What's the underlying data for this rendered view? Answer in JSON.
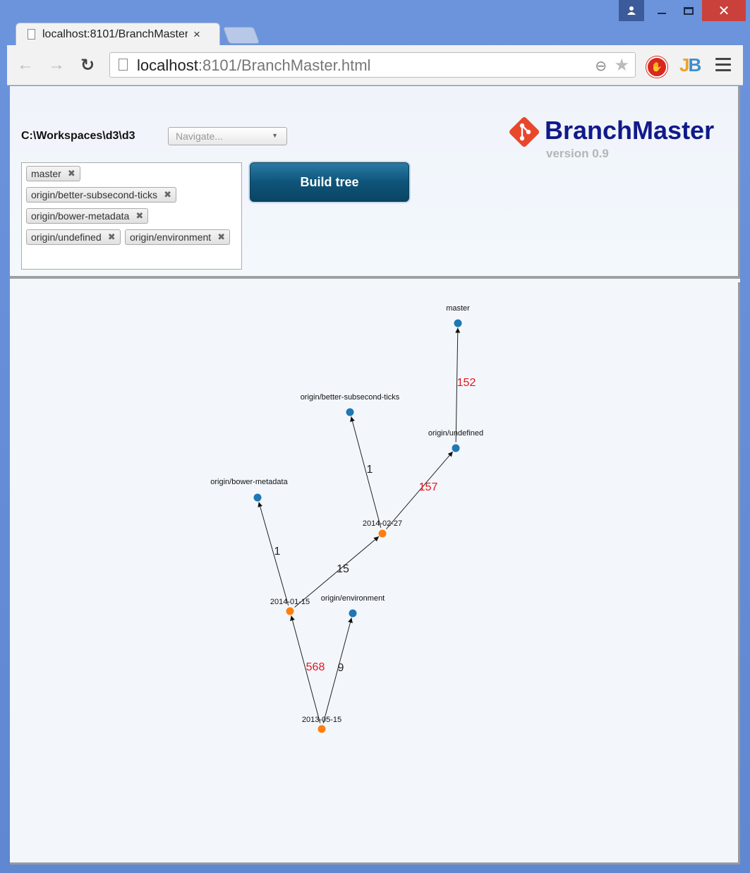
{
  "window": {
    "tab_title": "localhost:8101/BranchMaster.html",
    "close_glyph": "✕"
  },
  "toolbar": {
    "url_host": "localhost",
    "url_rest": ":8101/BranchMaster.html"
  },
  "app": {
    "path": "C:\\Workspaces\\d3\\d3",
    "navigate_placeholder": "Navigate...",
    "build_label": "Build tree",
    "brand": "BranchMaster",
    "version": "version 0.9",
    "brand_color": "#111a8a",
    "logo_color": "#e9472c"
  },
  "branches": [
    {
      "label": "master"
    },
    {
      "label": "origin/better-subsecond-ticks"
    },
    {
      "label": "origin/bower-metadata"
    },
    {
      "label": "origin/undefined"
    },
    {
      "label": "origin/environment"
    }
  ],
  "graph": {
    "colors": {
      "branch": "#1f77b4",
      "commit": "#ff7f0e",
      "highlight": "#e8141c",
      "normal": "#222222"
    },
    "nodes": [
      {
        "id": "master",
        "label": "master",
        "kind": "branch"
      },
      {
        "id": "better",
        "label": "origin/better-subsecond-ticks",
        "kind": "branch"
      },
      {
        "id": "undefined",
        "label": "origin/undefined",
        "kind": "branch"
      },
      {
        "id": "bower",
        "label": "origin/bower-metadata",
        "kind": "branch"
      },
      {
        "id": "c0227",
        "label": "2014-02-27",
        "kind": "commit"
      },
      {
        "id": "c0115",
        "label": "2014-01-15",
        "kind": "commit"
      },
      {
        "id": "environment",
        "label": "origin/environment",
        "kind": "branch"
      },
      {
        "id": "c0515",
        "label": "2013-05-15",
        "kind": "commit"
      }
    ],
    "edges": [
      {
        "from": "undefined",
        "to": "master",
        "label": "152",
        "highlight": true
      },
      {
        "from": "c0227",
        "to": "better",
        "label": "1",
        "highlight": false
      },
      {
        "from": "c0227",
        "to": "undefined",
        "label": "157",
        "highlight": true
      },
      {
        "from": "c0115",
        "to": "bower",
        "label": "1",
        "highlight": false
      },
      {
        "from": "c0115",
        "to": "c0227",
        "label": "15",
        "highlight": false
      },
      {
        "from": "c0515",
        "to": "c0115",
        "label": "568",
        "highlight": true
      },
      {
        "from": "c0515",
        "to": "environment",
        "label": "9",
        "highlight": false
      }
    ]
  }
}
